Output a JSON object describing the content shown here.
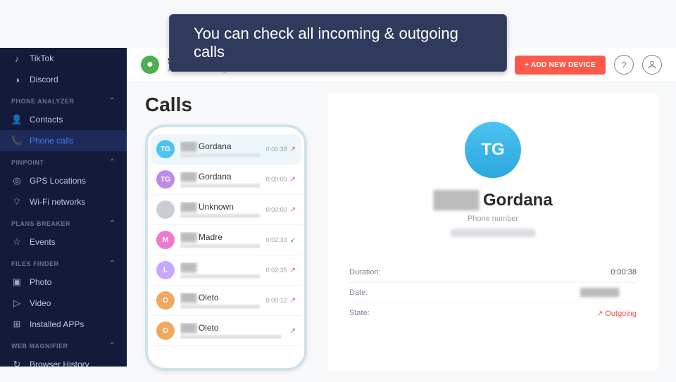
{
  "banner": "You can check all incoming & outgoing calls",
  "sidebar": {
    "items_top": [
      {
        "label": "TikTok",
        "icon": "♪"
      },
      {
        "label": "Discord",
        "icon": "◑"
      }
    ],
    "sections": [
      {
        "header": "PHONE ANALYZER",
        "items": [
          {
            "label": "Contacts",
            "icon": "👤"
          },
          {
            "label": "Phone calls",
            "icon": "📞",
            "active": true
          }
        ]
      },
      {
        "header": "PINPOINT",
        "items": [
          {
            "label": "GPS Locations",
            "icon": "◎"
          },
          {
            "label": "Wi-Fi networks",
            "icon": "⌔"
          }
        ]
      },
      {
        "header": "PLANS BREAKER",
        "items": [
          {
            "label": "Events",
            "icon": "☆"
          }
        ]
      },
      {
        "header": "FILES FINDER",
        "items": [
          {
            "label": "Photo",
            "icon": "▣"
          },
          {
            "label": "Video",
            "icon": "▷"
          },
          {
            "label": "Installed APPs",
            "icon": "⊞"
          }
        ]
      },
      {
        "header": "WEB MAGNIFIER",
        "items": [
          {
            "label": "Browser History",
            "icon": "↻"
          }
        ]
      }
    ]
  },
  "topbar": {
    "device_name": "SM-A217F",
    "device_sub": "Android Monitoring",
    "add_button": "+  ADD NEW DEVICE"
  },
  "page_title": "Calls",
  "call_list": [
    {
      "initials": "TG",
      "color": "#4cc3f0",
      "name": "Gordana",
      "time": "0:00:38",
      "dir": "out",
      "sel": true
    },
    {
      "initials": "TG",
      "color": "#b98ce6",
      "name": "Gordana",
      "time": "0:00:00",
      "dir": "out"
    },
    {
      "initials": "",
      "color": "#c9ccd4",
      "name": "Unknown",
      "time": "0:00:00",
      "dir": "out"
    },
    {
      "initials": "M",
      "color": "#ec7bd0",
      "name": "Madre",
      "time": "0:02:33",
      "dir": "in"
    },
    {
      "initials": "L",
      "color": "#c8a8ff",
      "name": "",
      "time": "0:02:35",
      "dir": "out"
    },
    {
      "initials": "O",
      "color": "#f0a860",
      "name": "Oleto",
      "time": "0:00:12",
      "dir": "out"
    },
    {
      "initials": "O",
      "color": "#f0a860",
      "name": "Oleto",
      "time": "",
      "dir": "out"
    }
  ],
  "detail": {
    "initials": "TG",
    "name": "Gordana",
    "subtitle": "Phone number",
    "rows": [
      {
        "label": "Duration:",
        "value": "0:00:38"
      },
      {
        "label": "Date:",
        "value": ""
      },
      {
        "label": "State:",
        "value": "↗ Outgoing",
        "out": true
      }
    ]
  }
}
